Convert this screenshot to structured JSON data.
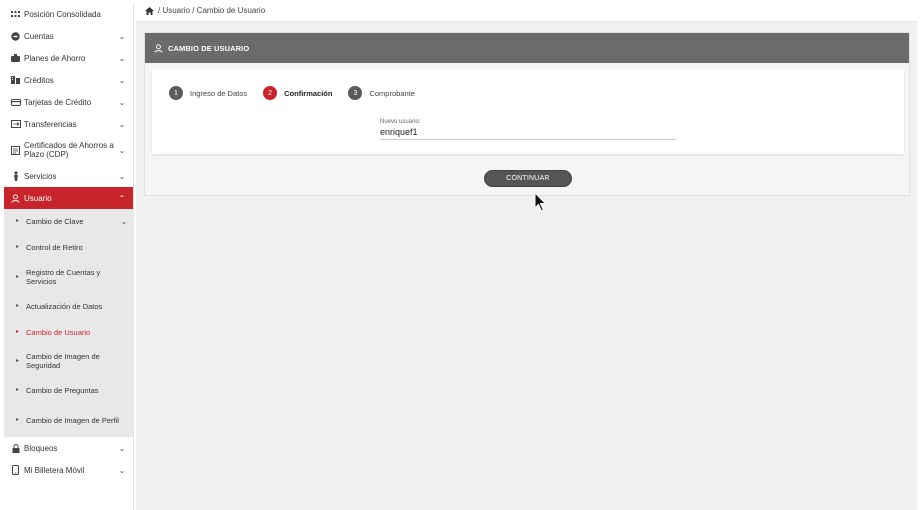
{
  "breadcrumb": {
    "text": "/ Usuario / Cambio de Usuario"
  },
  "sidebar": {
    "items": [
      {
        "label": "Posición Consolidada",
        "icon": "grid-icon",
        "chevron": false
      },
      {
        "label": "Cuentas",
        "icon": "coin-icon",
        "chevron": true
      },
      {
        "label": "Planes de Ahorro",
        "icon": "piggy-icon",
        "chevron": true
      },
      {
        "label": "Créditos",
        "icon": "building-icon",
        "chevron": true
      },
      {
        "label": "Tarjetas de Crédito",
        "icon": "card-icon",
        "chevron": true
      },
      {
        "label": "Transferencias",
        "icon": "transfer-icon",
        "chevron": true
      },
      {
        "label": "Certificados de Ahorros a Plazo (CDP)",
        "icon": "certificate-icon",
        "chevron": true
      },
      {
        "label": "Servicios",
        "icon": "service-icon",
        "chevron": true
      },
      {
        "label": "Usuario",
        "icon": "user-icon",
        "chevron": true,
        "active": true
      },
      {
        "label": "Bloqueos",
        "icon": "lock-icon",
        "chevron": true
      },
      {
        "label": "Mi Billetera Móvil",
        "icon": "phone-icon",
        "chevron": true
      }
    ],
    "submenu": [
      {
        "label": "Cambio de Clave",
        "chevron": true
      },
      {
        "label": "Control de Retiro"
      },
      {
        "label": "Registro de Cuentas y Servicios"
      },
      {
        "label": "Actualización de Datos"
      },
      {
        "label": "Cambio de Usuario",
        "active": true
      },
      {
        "label": "Cambio de Imagen de Seguridad"
      },
      {
        "label": "Cambio de Preguntas"
      },
      {
        "label": "Cambio de Imagen de Perfil"
      }
    ]
  },
  "panel": {
    "title": "CAMBIO DE USUARIO",
    "steps": [
      {
        "num": "1",
        "label": "Ingreso de Datos"
      },
      {
        "num": "2",
        "label": "Confirmación",
        "active": true
      },
      {
        "num": "3",
        "label": "Comprobante"
      }
    ],
    "field": {
      "label": "Nuevo usuario:",
      "value": "enriquef1"
    },
    "button": "CONTINUAR"
  },
  "colors": {
    "accent": "#c8242b",
    "header": "#6b6b6b",
    "button": "#555555"
  }
}
